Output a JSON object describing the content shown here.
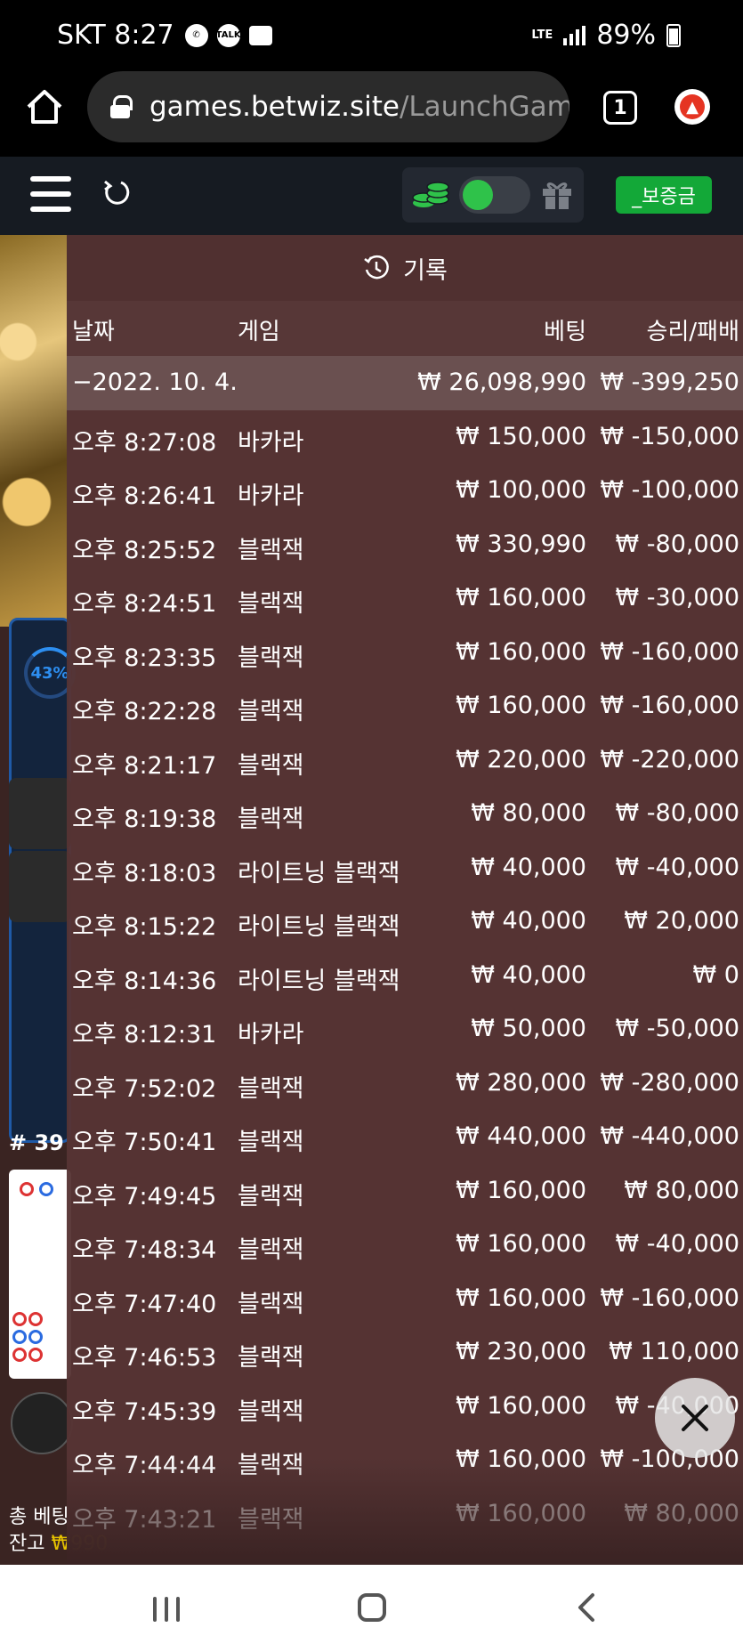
{
  "status_bar": {
    "carrier_time": "SKT 8:27",
    "talk_label": "TALK",
    "network": "LTE",
    "battery": "89%"
  },
  "browser": {
    "url_host": "games.betwiz.site",
    "url_path": "/LaunchGam",
    "tab_count": "1"
  },
  "game_bar": {
    "deposit_label": "_보증금"
  },
  "background": {
    "progress_label": "43%",
    "round_label": "# 39",
    "total_bet_label": "총 베팅",
    "balance_label": "잔고",
    "balance_value": "₩990"
  },
  "history": {
    "title": "기록",
    "columns": {
      "date": "날짜",
      "game": "게임",
      "bet": "베팅",
      "result": "승리/패배"
    },
    "summary": {
      "date": "−2022. 10. 4.",
      "bet": "₩ 26,098,990",
      "result": "₩ -399,250"
    },
    "rows": [
      {
        "time": "오후 8:27:08",
        "game": "바카라",
        "bet": "₩ 150,000",
        "result": "₩ -150,000"
      },
      {
        "time": "오후 8:26:41",
        "game": "바카라",
        "bet": "₩ 100,000",
        "result": "₩ -100,000"
      },
      {
        "time": "오후 8:25:52",
        "game": "블랙잭",
        "bet": "₩ 330,990",
        "result": "₩ -80,000"
      },
      {
        "time": "오후 8:24:51",
        "game": "블랙잭",
        "bet": "₩ 160,000",
        "result": "₩ -30,000"
      },
      {
        "time": "오후 8:23:35",
        "game": "블랙잭",
        "bet": "₩ 160,000",
        "result": "₩ -160,000"
      },
      {
        "time": "오후 8:22:28",
        "game": "블랙잭",
        "bet": "₩ 160,000",
        "result": "₩ -160,000"
      },
      {
        "time": "오후 8:21:17",
        "game": "블랙잭",
        "bet": "₩ 220,000",
        "result": "₩ -220,000"
      },
      {
        "time": "오후 8:19:38",
        "game": "블랙잭",
        "bet": "₩ 80,000",
        "result": "₩ -80,000"
      },
      {
        "time": "오후 8:18:03",
        "game": "라이트닝 블랙잭",
        "bet": "₩ 40,000",
        "result": "₩ -40,000"
      },
      {
        "time": "오후 8:15:22",
        "game": "라이트닝 블랙잭",
        "bet": "₩ 40,000",
        "result": "₩ 20,000"
      },
      {
        "time": "오후 8:14:36",
        "game": "라이트닝 블랙잭",
        "bet": "₩ 40,000",
        "result": "₩ 0"
      },
      {
        "time": "오후 8:12:31",
        "game": "바카라",
        "bet": "₩ 50,000",
        "result": "₩ -50,000"
      },
      {
        "time": "오후 7:52:02",
        "game": "블랙잭",
        "bet": "₩ 280,000",
        "result": "₩ -280,000"
      },
      {
        "time": "오후 7:50:41",
        "game": "블랙잭",
        "bet": "₩ 440,000",
        "result": "₩ -440,000"
      },
      {
        "time": "오후 7:49:45",
        "game": "블랙잭",
        "bet": "₩ 160,000",
        "result": "₩ 80,000"
      },
      {
        "time": "오후 7:48:34",
        "game": "블랙잭",
        "bet": "₩ 160,000",
        "result": "₩ -40,000"
      },
      {
        "time": "오후 7:47:40",
        "game": "블랙잭",
        "bet": "₩ 160,000",
        "result": "₩ -160,000"
      },
      {
        "time": "오후 7:46:53",
        "game": "블랙잭",
        "bet": "₩ 230,000",
        "result": "₩ 110,000"
      },
      {
        "time": "오후 7:45:39",
        "game": "블랙잭",
        "bet": "₩ 160,000",
        "result": "₩ -40,000"
      },
      {
        "time": "오후 7:44:44",
        "game": "블랙잭",
        "bet": "₩ 160,000",
        "result": "₩ -100,000"
      },
      {
        "time": "오후 7:43:21",
        "game": "블랙잭",
        "bet": "₩ 160,000",
        "result": "₩ 80,000"
      }
    ]
  },
  "colors": {
    "overlay": "#563434",
    "summary_row": "#6a5050",
    "deposit_green": "#13a838",
    "toggle_green": "#2fc24a"
  },
  "icons": [
    "home-icon",
    "lock-icon",
    "tabs-icon",
    "update-icon",
    "menu-icon",
    "refresh-icon",
    "coins-icon",
    "gift-icon",
    "clock-icon",
    "close-icon",
    "recents-icon",
    "nav-home-icon",
    "back-icon"
  ]
}
